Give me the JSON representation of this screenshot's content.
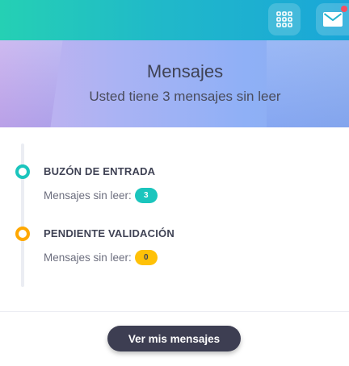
{
  "topbar": {
    "apps_icon": "grid-icon",
    "mail_icon": "envelope-icon",
    "notification_color": "#f64e60"
  },
  "header": {
    "title": "Mensajes",
    "subtitle": "Usted tiene 3 mensajes sin leer"
  },
  "timeline": {
    "items": [
      {
        "heading": "BUZÓN DE ENTRADA",
        "label": "Mensajes sin leer:",
        "count": "3",
        "color": "#1bc5bd"
      },
      {
        "heading": "PENDIENTE VALIDACIÓN",
        "label": "Mensajes sin leer:",
        "count": "0",
        "color": "#ffa800"
      }
    ]
  },
  "footer": {
    "button_label": "Ver mis mensajes"
  }
}
